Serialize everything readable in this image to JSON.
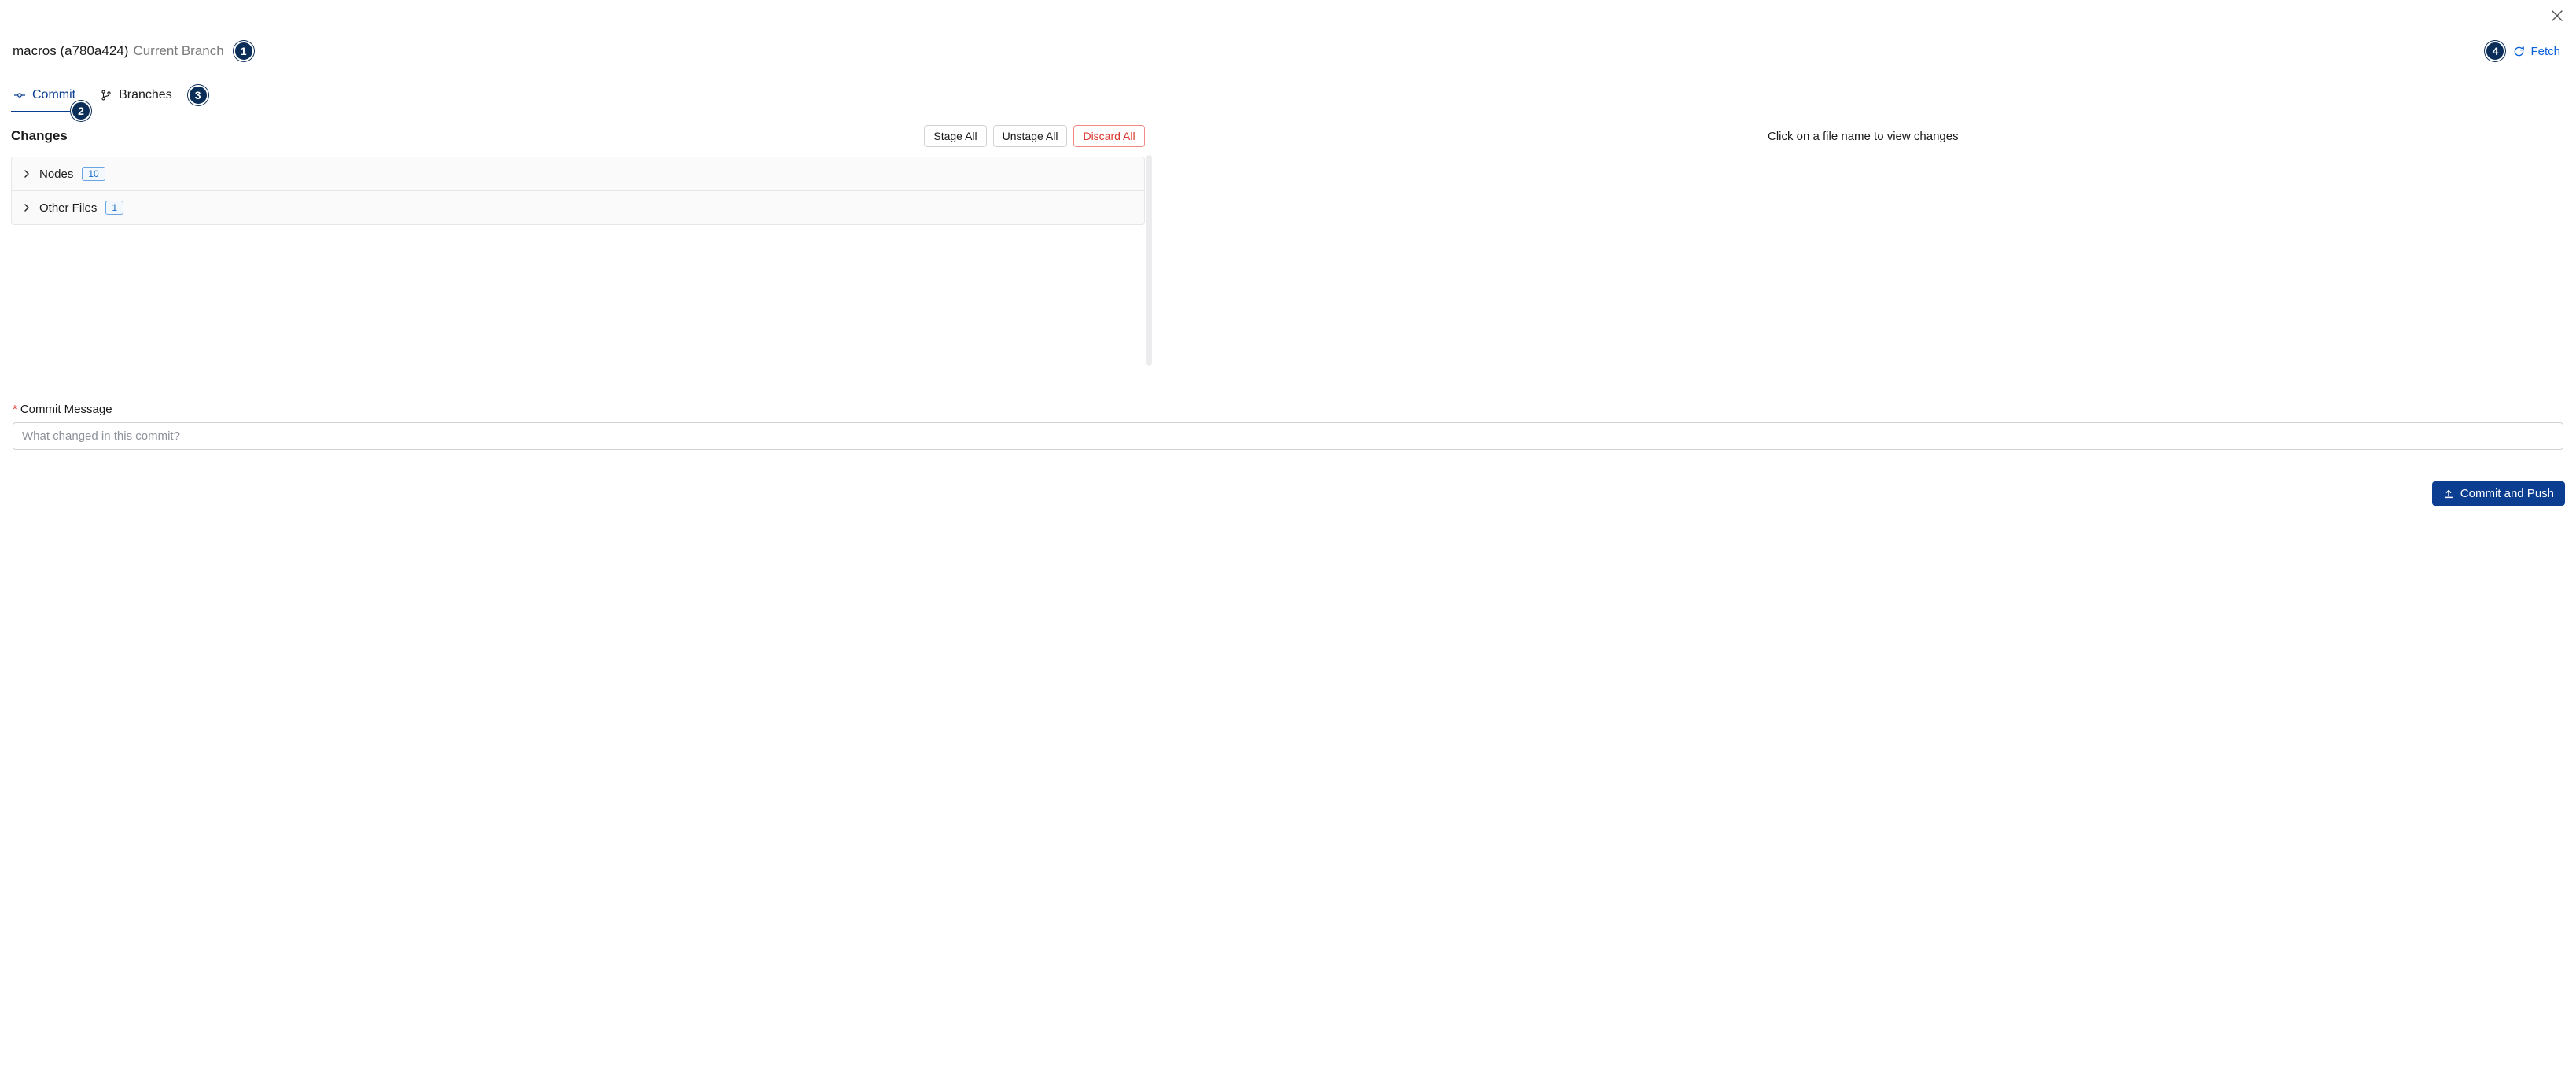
{
  "header": {
    "branch_name": "macros (a780a424)",
    "branch_sub": "Current Branch",
    "fetch_label": "Fetch"
  },
  "tabs": {
    "commit_label": "Commit",
    "branches_label": "Branches"
  },
  "changes": {
    "title": "Changes",
    "stage_all_label": "Stage All",
    "unstage_all_label": "Unstage All",
    "discard_all_label": "Discard All",
    "groups": [
      {
        "label": "Nodes",
        "count": "10"
      },
      {
        "label": "Other Files",
        "count": "1"
      }
    ]
  },
  "right_pane": {
    "empty_hint": "Click on a file name to view changes"
  },
  "form": {
    "label": "Commit Message",
    "placeholder": "What changed in this commit?",
    "submit_label": "Commit and Push"
  },
  "annotations": {
    "a1": "1",
    "a2": "2",
    "a3": "3",
    "a4": "4"
  }
}
